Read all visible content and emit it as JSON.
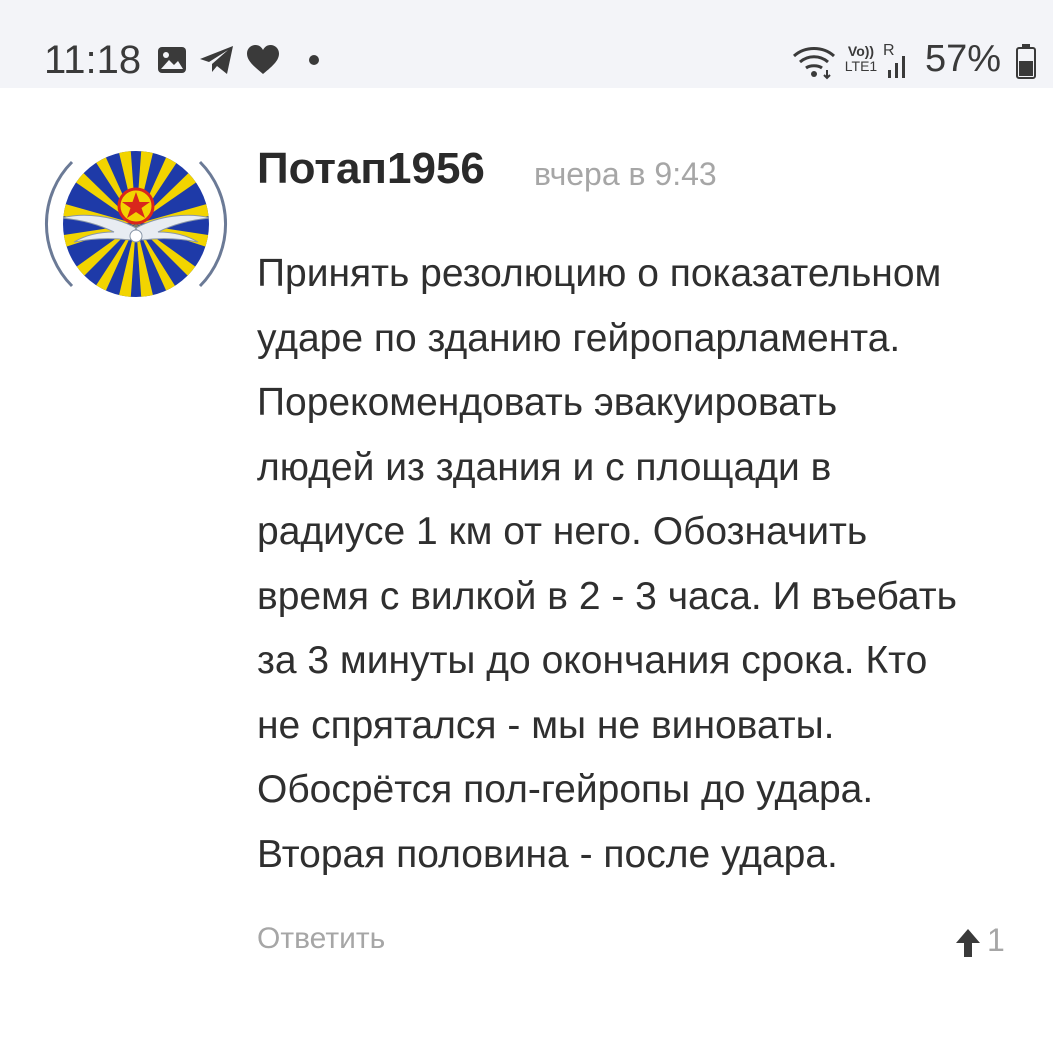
{
  "status_bar": {
    "time": "11:18",
    "left_icons": [
      "image-icon",
      "telegram-icon",
      "heart-icon",
      "dot-icon"
    ],
    "right_icons": [
      "wifi-icon",
      "volte-icon",
      "signal-icon"
    ],
    "network_label_top": "Vo))",
    "network_label_bottom": "LTE1",
    "roaming_label": "R",
    "battery_percent": "57%"
  },
  "comment": {
    "author": "Потап1956",
    "timestamp": "вчера в 9:43",
    "avatar_icon": "air-force-emblem-icon",
    "body_lines": [
      "Принять резолюцию о показательном",
      "ударе по зданию гейропарламента.",
      "Порекомендовать эвакуировать",
      "людей из здания и с площади в",
      "радиусе 1 км от него. Обозначить",
      "время с вилкой в 2 - 3 часа. И въебать",
      "за 3 минуты до окончания срока. Кто",
      "не спрятался - мы не виноваты.",
      "Обосрётся пол-гейропы до удара.",
      "Вторая половина - после удара."
    ],
    "reply_label": "Ответить",
    "vote_count": "1"
  },
  "colors": {
    "status_bar_bg": "#f3f4f8",
    "text_primary": "#2f2f2f",
    "text_muted": "#a6a6a6",
    "emblem_blue": "#1e3aa8",
    "emblem_yellow": "#f2d400",
    "emblem_red": "#d9261c"
  }
}
